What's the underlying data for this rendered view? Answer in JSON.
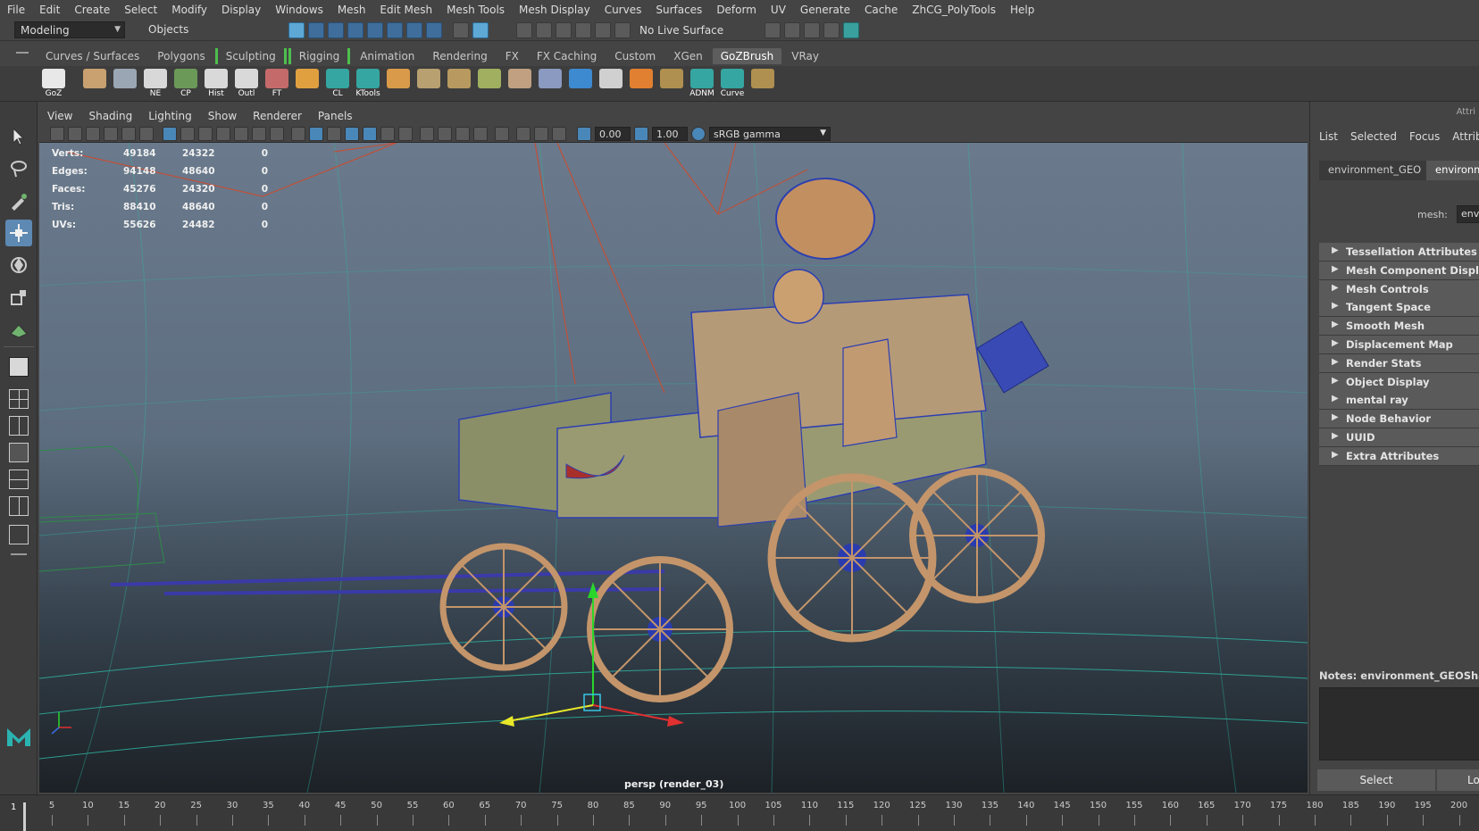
{
  "menubar": [
    "File",
    "Edit",
    "Create",
    "Select",
    "Modify",
    "Display",
    "Windows",
    "Mesh",
    "Edit Mesh",
    "Mesh Tools",
    "Mesh Display",
    "Curves",
    "Surfaces",
    "Deform",
    "UV",
    "Generate",
    "Cache",
    "ZhCG_PolyTools",
    "Help"
  ],
  "status": {
    "mode": "Modeling",
    "selection_mode": "Objects",
    "live_surface": "No Live Surface"
  },
  "shelf_tabs": [
    "Curves / Surfaces",
    "Polygons",
    "Sculpting",
    "Rigging",
    "Animation",
    "Rendering",
    "FX",
    "FX Caching",
    "Custom",
    "XGen",
    "GoZBrush",
    "VRay"
  ],
  "shelf_active_tab": "GoZBrush",
  "shelf_buttons": [
    {
      "name": "goz-button",
      "label": "GoZ",
      "color": "#e8e8e8"
    },
    {
      "name": "shelf-tool-2",
      "label": "",
      "color": "#c9a070"
    },
    {
      "name": "shelf-tool-3",
      "label": "",
      "color": "#9aa6b4"
    },
    {
      "name": "ne-button",
      "label": "NE",
      "color": "#d8d8d8"
    },
    {
      "name": "cp-button",
      "label": "CP",
      "color": "#6b9a58"
    },
    {
      "name": "hist-button",
      "label": "Hist",
      "color": "#d9d9d9"
    },
    {
      "name": "outl-button",
      "label": "Outl",
      "color": "#d9d9d9"
    },
    {
      "name": "ft-button",
      "label": "FT",
      "color": "#c46a6a"
    },
    {
      "name": "shelf-tool-9",
      "label": "",
      "color": "#e0a040"
    },
    {
      "name": "cl-button",
      "label": "CL",
      "color": "#35a6a2"
    },
    {
      "name": "ktools-button",
      "label": "KTools",
      "color": "#35a6a2"
    },
    {
      "name": "shelf-tool-12",
      "label": "",
      "color": "#d99a4a"
    },
    {
      "name": "shelf-tool-13",
      "label": "",
      "color": "#b8a070"
    },
    {
      "name": "shelf-tool-14",
      "label": "",
      "color": "#b89a60"
    },
    {
      "name": "shelf-tool-15",
      "label": "",
      "color": "#a0b060"
    },
    {
      "name": "shelf-tool-16",
      "label": "",
      "color": "#c0a080"
    },
    {
      "name": "shelf-tool-17",
      "label": "",
      "color": "#8a9ac0"
    },
    {
      "name": "shelf-tool-18",
      "label": "",
      "color": "#3d8ad0"
    },
    {
      "name": "shelf-tool-19",
      "label": "",
      "color": "#d0d0d0"
    },
    {
      "name": "shelf-tool-20",
      "label": "",
      "color": "#e08030"
    },
    {
      "name": "shelf-tool-21",
      "label": "",
      "color": "#b09050"
    },
    {
      "name": "adnm-button",
      "label": "ADNM",
      "color": "#35a6a2"
    },
    {
      "name": "curve-button",
      "label": "Curve",
      "color": "#35a6a2"
    },
    {
      "name": "shelf-tool-24",
      "label": "",
      "color": "#b09050"
    }
  ],
  "panel_menu": [
    "View",
    "Shading",
    "Lighting",
    "Show",
    "Renderer",
    "Panels"
  ],
  "panel_fields": {
    "near": "0.00",
    "far": "1.00",
    "color_space": "sRGB gamma"
  },
  "hud": [
    {
      "k": "Verts:",
      "a": "49184",
      "b": "24322",
      "c": "0"
    },
    {
      "k": "Edges:",
      "a": "94148",
      "b": "48640",
      "c": "0"
    },
    {
      "k": "Faces:",
      "a": "45276",
      "b": "24320",
      "c": "0"
    },
    {
      "k": "Tris:",
      "a": "88410",
      "b": "48640",
      "c": "0"
    },
    {
      "k": "UVs:",
      "a": "55626",
      "b": "24482",
      "c": "0"
    }
  ],
  "camera_label": "persp (render_03)",
  "attr": {
    "header": "Attri",
    "menu": [
      "List",
      "Selected",
      "Focus",
      "Attribut"
    ],
    "tabs": [
      "environment_GEO",
      "environme"
    ],
    "mesh_label": "mesh:",
    "mesh_value": "envi",
    "sections": [
      "Tessellation Attributes",
      "Mesh Component Display",
      "Mesh Controls",
      "Tangent Space",
      "Smooth Mesh",
      "Displacement Map",
      "Render Stats",
      "Object Display",
      "mental ray",
      "Node Behavior",
      "UUID",
      "Extra Attributes"
    ],
    "notes_label": "Notes:  environment_GEOShape",
    "select_button": "Select",
    "load_button": "Lo"
  },
  "timeline": {
    "current": "1",
    "ticks": [
      "5",
      "10",
      "15",
      "20",
      "25",
      "30",
      "35",
      "40",
      "45",
      "50",
      "55",
      "60",
      "65",
      "70",
      "75",
      "80",
      "85",
      "90",
      "95",
      "100",
      "105",
      "110",
      "115",
      "120",
      "125",
      "130",
      "135",
      "140",
      "145",
      "150",
      "155",
      "160",
      "165",
      "170",
      "175",
      "180",
      "185",
      "190",
      "195",
      "200"
    ]
  }
}
